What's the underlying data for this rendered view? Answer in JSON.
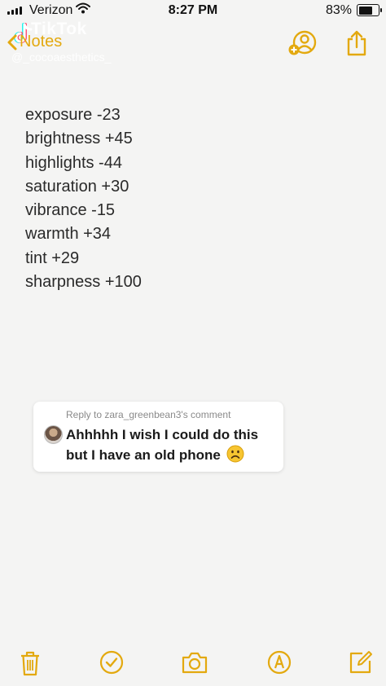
{
  "status_bar": {
    "carrier": "Verizon",
    "time": "8:27 PM",
    "battery_percent": "83%",
    "battery_level": 0.83
  },
  "watermark": {
    "brand": "TikTok",
    "username": "@_cocoaesthetics_"
  },
  "nav": {
    "back_label": "Notes"
  },
  "note": {
    "lines": [
      "exposure -23",
      "brightness +45",
      "highlights -44",
      "saturation +30",
      "vibrance -15",
      "warmth +34",
      "tint +29",
      "sharpness +100"
    ]
  },
  "comment": {
    "reply_to": "Reply to zara_greenbean3's comment",
    "text": "Ahhhhh I wish I could do this but I have an old phone"
  },
  "colors": {
    "accent": "#e3a90f",
    "background": "#f4f4f3"
  },
  "icons": [
    "chevron-left-icon",
    "add-person-icon",
    "share-icon",
    "trash-icon",
    "checklist-icon",
    "camera-icon",
    "markup-icon",
    "compose-icon",
    "frown-emoji-icon"
  ]
}
